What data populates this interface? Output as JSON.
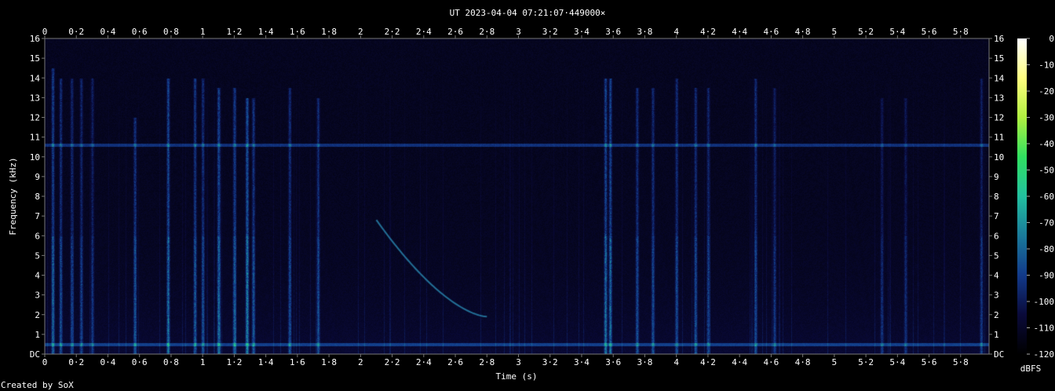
{
  "chart_data": {
    "type": "heatmap",
    "title": "UT 2023-04-04 07:21:07·449000×",
    "xlabel": "Time (s)",
    "ylabel": "Frequency (kHz)",
    "xlim": [
      0,
      5.98
    ],
    "ylim": [
      0,
      16
    ],
    "x_ticks": [
      "0",
      "0·2",
      "0·4",
      "0·6",
      "0·8",
      "1",
      "1·2",
      "1·4",
      "1·6",
      "1·8",
      "2",
      "2·2",
      "2·4",
      "2·6",
      "2·8",
      "3",
      "3·2",
      "3·4",
      "3·6",
      "3·8",
      "4",
      "4·2",
      "4·4",
      "4·6",
      "4·8",
      "5",
      "5·2",
      "5·4",
      "5·6",
      "5·8"
    ],
    "y_ticks": [
      "DC",
      "1",
      "2",
      "3",
      "4",
      "5",
      "6",
      "7",
      "8",
      "9",
      "10",
      "11",
      "12",
      "13",
      "14",
      "15",
      "16"
    ],
    "colorbar": {
      "label": "dBFS",
      "ticks": [
        "0",
        "-10",
        "-20",
        "-30",
        "-40",
        "-50",
        "-60",
        "-70",
        "-80",
        "-90",
        "-100",
        "-110",
        "-120"
      ],
      "range": [
        -120,
        0
      ],
      "colors": [
        "#000000",
        "#0a0a3a",
        "#123a8a",
        "#1a7a9a",
        "#22c0a0",
        "#30e060",
        "#b0f040",
        "#ffff80",
        "#ffffff"
      ]
    },
    "features": {
      "background_dbfs": -115,
      "hum_lines_khz": [
        0.5,
        10.6
      ],
      "sweep": {
        "start_t": 2.1,
        "start_khz": 6.8,
        "end_t": 2.8,
        "end_khz": 1.9
      },
      "impulses": [
        {
          "t": 0.05,
          "top_khz": 14.5,
          "level": 0.55
        },
        {
          "t": 0.1,
          "top_khz": 14,
          "level": 0.45
        },
        {
          "t": 0.17,
          "top_khz": 14,
          "level": 0.4
        },
        {
          "t": 0.23,
          "top_khz": 14,
          "level": 0.4
        },
        {
          "t": 0.3,
          "top_khz": 14,
          "level": 0.35
        },
        {
          "t": 0.57,
          "top_khz": 12,
          "level": 0.5
        },
        {
          "t": 0.78,
          "top_khz": 14,
          "level": 0.6
        },
        {
          "t": 0.95,
          "top_khz": 14,
          "level": 0.5
        },
        {
          "t": 1.0,
          "top_khz": 14,
          "level": 0.45
        },
        {
          "t": 1.1,
          "top_khz": 13.5,
          "level": 0.6
        },
        {
          "t": 1.2,
          "top_khz": 13.5,
          "level": 0.55
        },
        {
          "t": 1.28,
          "top_khz": 13,
          "level": 0.7
        },
        {
          "t": 1.32,
          "top_khz": 13,
          "level": 0.5
        },
        {
          "t": 1.55,
          "top_khz": 13.5,
          "level": 0.45
        },
        {
          "t": 1.73,
          "top_khz": 13,
          "level": 0.45
        },
        {
          "t": 3.55,
          "top_khz": 14,
          "level": 0.6
        },
        {
          "t": 3.58,
          "top_khz": 14,
          "level": 0.6
        },
        {
          "t": 3.75,
          "top_khz": 13.5,
          "level": 0.45
        },
        {
          "t": 3.85,
          "top_khz": 13.5,
          "level": 0.45
        },
        {
          "t": 4.0,
          "top_khz": 14,
          "level": 0.45
        },
        {
          "t": 4.12,
          "top_khz": 13.5,
          "level": 0.45
        },
        {
          "t": 4.2,
          "top_khz": 13.5,
          "level": 0.4
        },
        {
          "t": 4.5,
          "top_khz": 14,
          "level": 0.45
        },
        {
          "t": 4.62,
          "top_khz": 13.5,
          "level": 0.35
        },
        {
          "t": 5.3,
          "top_khz": 13,
          "level": 0.3
        },
        {
          "t": 5.45,
          "top_khz": 13,
          "level": 0.3
        },
        {
          "t": 5.93,
          "top_khz": 14,
          "level": 0.35
        }
      ]
    }
  },
  "credit": "Created by SoX"
}
